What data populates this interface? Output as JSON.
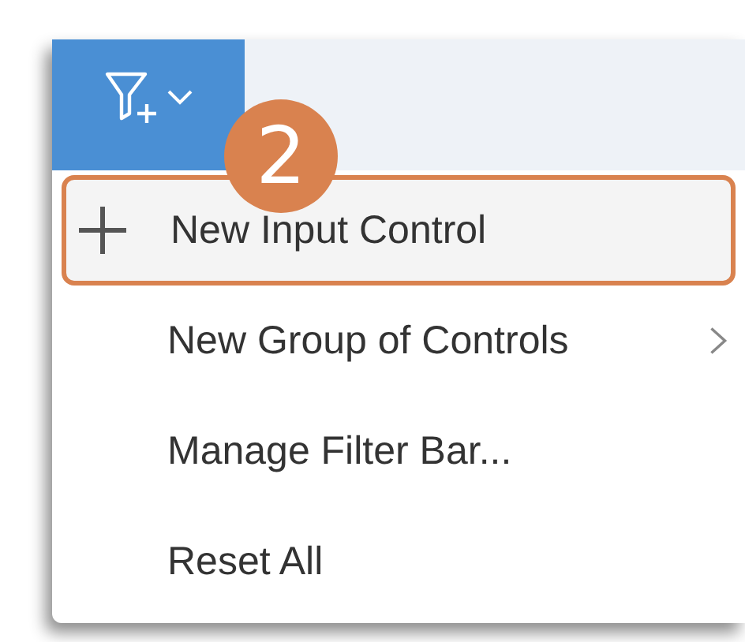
{
  "toolbar": {
    "filter_button": {
      "pressed": true
    }
  },
  "step_badge": {
    "label": "2"
  },
  "menu": {
    "items": [
      {
        "label": "New Input Control",
        "kind": "add",
        "highlighted": true
      },
      {
        "label": "New Group of Controls",
        "kind": "submenu",
        "highlighted": false
      },
      {
        "label": "Manage Filter Bar...",
        "kind": "plain",
        "highlighted": false
      },
      {
        "label": "Reset All",
        "kind": "plain",
        "highlighted": false
      }
    ]
  }
}
